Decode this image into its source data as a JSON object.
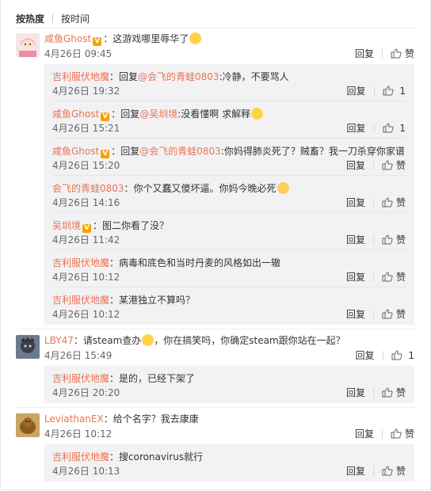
{
  "tabs": {
    "hot": "按热度",
    "time": "按时间"
  },
  "labels": {
    "reply": "回复",
    "like": "赞"
  },
  "comments": [
    {
      "user": "咸鱼Ghost",
      "text": "：这游戏哪里辱华了",
      "time": "4月26日 09:45",
      "likes": "赞"
    },
    {
      "user": "LBY47",
      "text": "：请steam查办",
      "text2": "，你在搞笑吗，你确定steam跟你站在一起？",
      "time": "4月26日 15:49",
      "likes": "1"
    },
    {
      "user": "LeviathanEX",
      "text": "：给个名字？我去康康",
      "time": "4月26日 10:12",
      "likes": "赞"
    }
  ],
  "replies1": [
    {
      "user": "吉利服伏地魔",
      "pre": "：回复",
      "at": "@会飞的青蛙0803",
      "text": ":冷静，不要骂人",
      "time": "4月26日 19:32",
      "likes": "1"
    },
    {
      "user": "咸鱼Ghost",
      "pre": "：回复",
      "at": "@吴圳境",
      "text": ":没看懂啊 求解释",
      "time": "4月26日 15:21",
      "likes": "1"
    },
    {
      "user": "咸鱼Ghost",
      "pre": "：回复",
      "at": "@会飞的青蛙0803",
      "text": ":你妈得肺炎死了？贼畜？我一刀杀穿你家谱",
      "time": "4月26日 15:20",
      "likes": "赞"
    },
    {
      "user": "会飞的青蛙0803",
      "text": "：你个又蠢又傻坏逼。你妈今晚必死",
      "time": "4月26日 14:16",
      "likes": "赞"
    },
    {
      "user": "吴圳境",
      "text": "：图二你看了没？",
      "time": "4月26日 11:42",
      "likes": "赞"
    },
    {
      "user": "吉利服伏地魔",
      "text": "：病毒和底色和当时丹麦的风格如出一辙",
      "time": "4月26日 10:12",
      "likes": "赞"
    },
    {
      "user": "吉利服伏地魔",
      "text": "：某港独立不算吗？",
      "time": "4月26日 10:12",
      "likes": "赞"
    }
  ],
  "replies2": [
    {
      "user": "吉利服伏地魔",
      "text": "：是的，已经下架了",
      "time": "4月26日 20:20",
      "likes": "赞"
    }
  ],
  "replies3": [
    {
      "user": "吉利服伏地魔",
      "text": "：搜coronavirus就行",
      "time": "4月26日 10:13",
      "likes": "赞"
    }
  ]
}
